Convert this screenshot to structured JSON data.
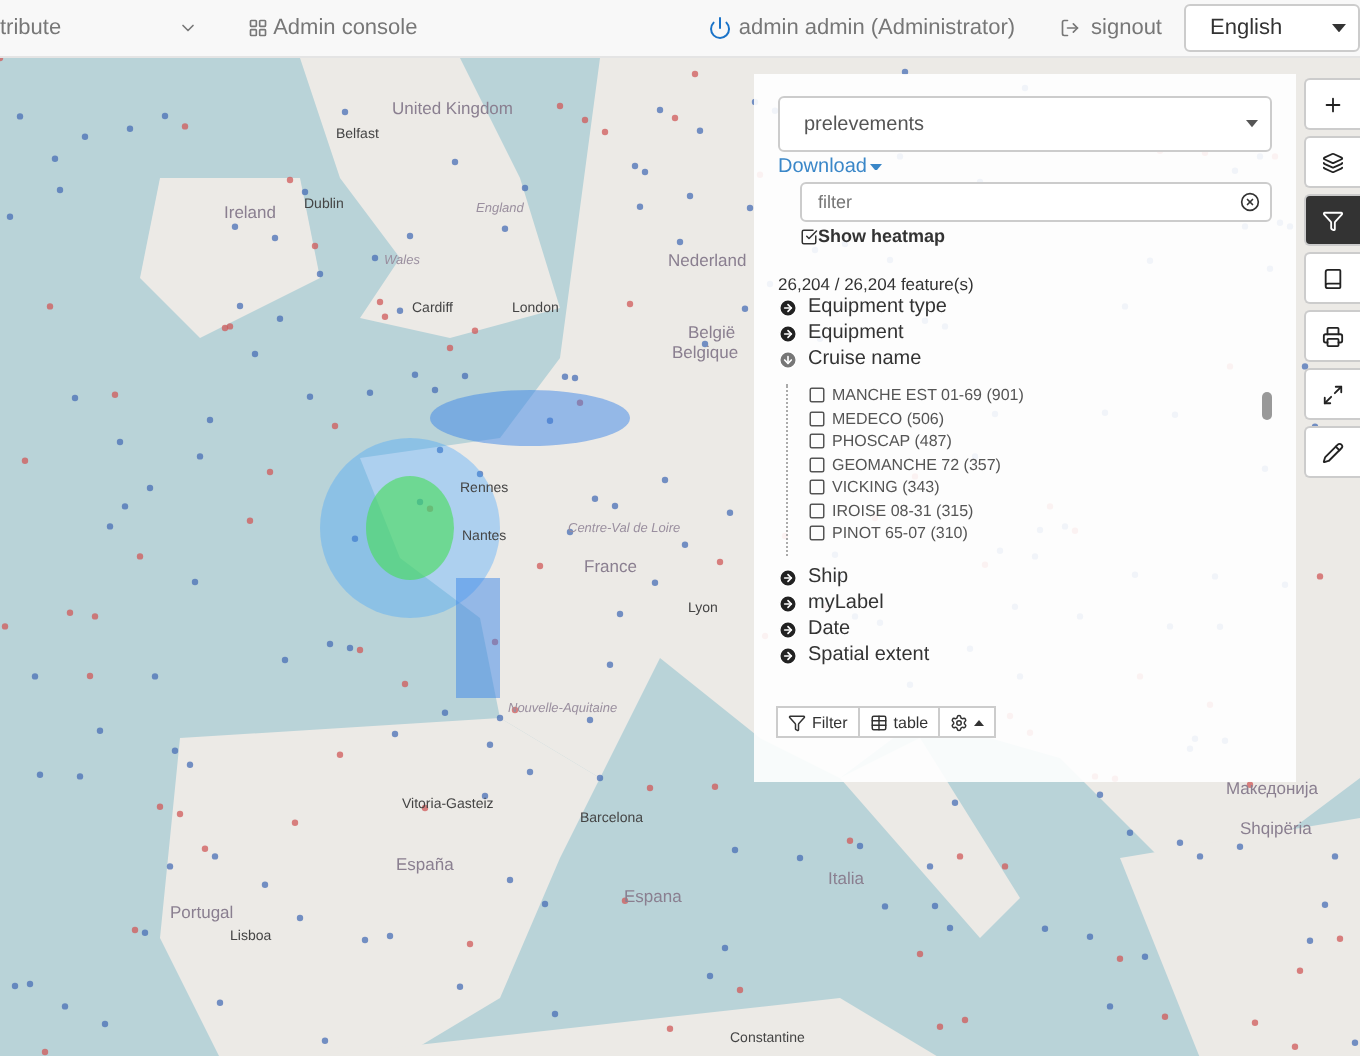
{
  "top_bar": {
    "menu_items": [
      {
        "label": "tribute",
        "kind": "dropdown"
      },
      {
        "label": "Admin console",
        "kind": "grid"
      }
    ],
    "user": "admin admin (Administrator)",
    "signout": "signout",
    "language": "English"
  },
  "map": {
    "labels": [
      {
        "text": "United Kingdom",
        "kind": "country"
      },
      {
        "text": "Belfast",
        "kind": "city"
      },
      {
        "text": "Ireland",
        "kind": "country"
      },
      {
        "text": "Dublin",
        "kind": "city"
      },
      {
        "text": "England",
        "kind": "region"
      },
      {
        "text": "Wales",
        "kind": "region"
      },
      {
        "text": "Cardiff",
        "kind": "city"
      },
      {
        "text": "London",
        "kind": "city"
      },
      {
        "text": "Nederland",
        "kind": "country"
      },
      {
        "text": "België",
        "kind": "country"
      },
      {
        "text": "Belgique",
        "kind": "country"
      },
      {
        "text": "Rennes",
        "kind": "city"
      },
      {
        "text": "Nantes",
        "kind": "city"
      },
      {
        "text": "Centre-Val de Loire",
        "kind": "region"
      },
      {
        "text": "France",
        "kind": "country"
      },
      {
        "text": "Lyon",
        "kind": "city"
      },
      {
        "text": "Nouvelle-Aquitaine",
        "kind": "region"
      },
      {
        "text": "Vitoria-Gasteiz",
        "kind": "city"
      },
      {
        "text": "Portugal",
        "kind": "country"
      },
      {
        "text": "España",
        "kind": "country"
      },
      {
        "text": "Barcelona",
        "kind": "city"
      },
      {
        "text": "Lisboa",
        "kind": "city"
      },
      {
        "text": "Espana",
        "kind": "country"
      },
      {
        "text": "Italia",
        "kind": "country"
      },
      {
        "text": "Constantine",
        "kind": "city"
      },
      {
        "text": "Shqipëria",
        "kind": "country"
      },
      {
        "text": "Македонија",
        "kind": "country"
      }
    ]
  },
  "panel": {
    "layer_select": "prelevements",
    "download": "Download",
    "filter_placeholder": "filter",
    "show_heatmap": {
      "label": "Show heatmap",
      "checked": true
    },
    "feature_count": "26,204 / 26,204 feature(s)",
    "facets": [
      {
        "label": "Equipment type",
        "expanded": false
      },
      {
        "label": "Equipment",
        "expanded": false
      },
      {
        "label": "Cruise name",
        "expanded": true,
        "options": [
          {
            "label": "MANCHE EST 01-69 (901)",
            "checked": false
          },
          {
            "label": "MEDECO (506)",
            "checked": false
          },
          {
            "label": "PHOSCAP (487)",
            "checked": false
          },
          {
            "label": "GEOMANCHE 72 (357)",
            "checked": false
          },
          {
            "label": "VICKING (343)",
            "checked": false
          },
          {
            "label": "IROISE 08-31 (315)",
            "checked": false
          },
          {
            "label": "PINOT 65-07 (310)",
            "checked": false
          }
        ]
      },
      {
        "label": "Ship",
        "expanded": false
      },
      {
        "label": "myLabel",
        "expanded": false
      },
      {
        "label": "Date",
        "expanded": false
      },
      {
        "label": "Spatial extent",
        "expanded": false
      }
    ],
    "footer_buttons": [
      {
        "label": "Filter",
        "kind": "filter"
      },
      {
        "label": "table",
        "kind": "table"
      },
      {
        "kind": "settings"
      }
    ]
  },
  "tools": [
    {
      "kind": "zoom-in",
      "selected": false
    },
    {
      "kind": "layers",
      "selected": false
    },
    {
      "kind": "filter",
      "selected": true
    },
    {
      "kind": "book",
      "selected": false
    },
    {
      "kind": "print",
      "selected": false
    },
    {
      "kind": "fullscreen",
      "selected": false
    },
    {
      "kind": "edit",
      "selected": false
    }
  ]
}
